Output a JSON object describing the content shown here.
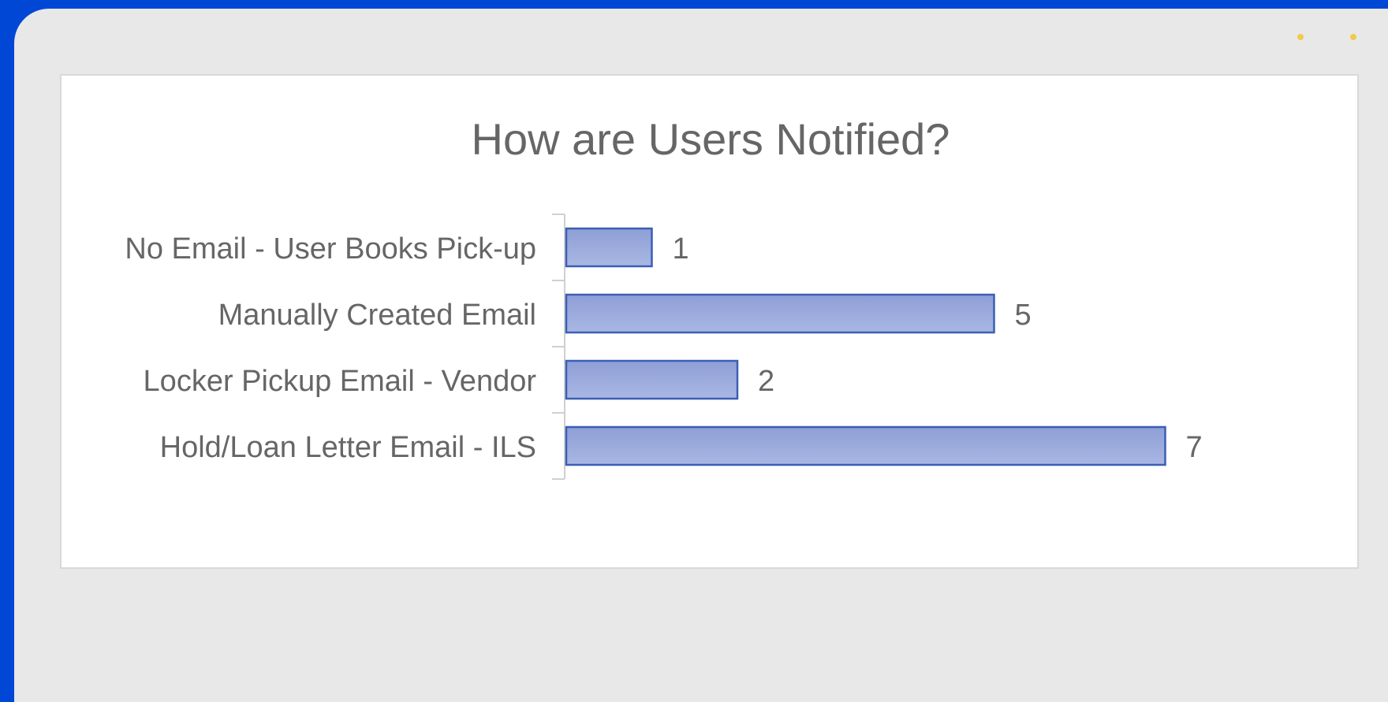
{
  "window": {
    "dots": [
      {
        "name": "yellow-dot-1",
        "color": "#f2c94c"
      },
      {
        "name": "yellow-dot-2",
        "color": "#f2c94c"
      }
    ]
  },
  "colors": {
    "background": "#0047d6",
    "frame": "#e8e8e8",
    "bar_fill_top": "#8e9fd6",
    "bar_fill_bottom": "#a9b7e3",
    "bar_stroke": "#3a5fb5",
    "text": "#666666",
    "axis": "#d0d0d0"
  },
  "chart_data": {
    "type": "bar",
    "orientation": "horizontal",
    "title": "How are Users Notified?",
    "categories": [
      "No Email - User Books Pick-up",
      "Manually Created Email",
      "Locker Pickup Email - Vendor",
      "Hold/Loan Letter Email - ILS"
    ],
    "values": [
      1,
      5,
      2,
      7
    ],
    "data_labels": [
      "1",
      "5",
      "2",
      "7"
    ],
    "xlim": [
      0,
      7
    ],
    "grid": false,
    "legend": "none"
  }
}
